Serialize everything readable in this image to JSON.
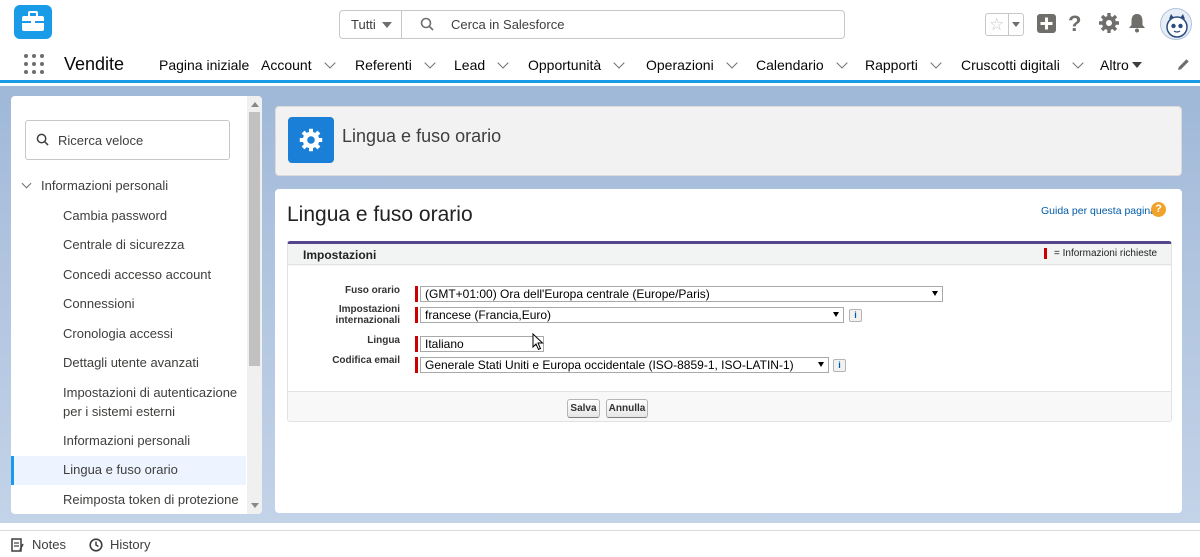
{
  "header": {
    "search_scope": "Tutti",
    "search_placeholder": "Cerca in Salesforce"
  },
  "nav": {
    "app_name": "Vendite",
    "items": [
      {
        "label": "Pagina iniziale",
        "has_menu": false
      },
      {
        "label": "Account",
        "has_menu": true
      },
      {
        "label": "Referenti",
        "has_menu": true
      },
      {
        "label": "Lead",
        "has_menu": true
      },
      {
        "label": "Opportunità",
        "has_menu": true
      },
      {
        "label": "Operazioni",
        "has_menu": true
      },
      {
        "label": "Calendario",
        "has_menu": true
      },
      {
        "label": "Rapporti",
        "has_menu": true
      },
      {
        "label": "Cruscotti digitali",
        "has_menu": true
      }
    ],
    "more_label": "Altro"
  },
  "sidebar": {
    "quick_search_placeholder": "Ricerca veloce",
    "section_title": "Informazioni personali",
    "items": [
      "Cambia password",
      "Centrale di sicurezza",
      "Concedi accesso account",
      "Connessioni",
      "Cronologia accessi",
      "Dettagli utente avanzati",
      "Impostazioni di autenticazione per i sistemi esterni",
      "Informazioni personali",
      "Lingua e fuso orario",
      "Reimposta token di protezione"
    ],
    "active_item": "Lingua e fuso orario"
  },
  "page_header": {
    "title": "Lingua e fuso orario"
  },
  "main": {
    "title": "Lingua e fuso orario",
    "help_link": "Guida per questa pagina",
    "help_icon": "?",
    "section_title": "Impostazioni",
    "required_note": "= Informazioni richieste",
    "fields": {
      "timezone_label": "Fuso orario",
      "timezone_value": "(GMT+01:00) Ora dell'Europa centrale (Europe/Paris)",
      "locale_label_1": "Impostazioni",
      "locale_label_2": "internazionali",
      "locale_value": "francese (Francia,Euro)",
      "language_label": "Lingua",
      "language_value": "Italiano",
      "encoding_label": "Codifica email",
      "encoding_value": "Generale Stati Uniti e Europa occidentale (ISO-8859-1, ISO-LATIN-1)"
    },
    "info_icon": "i",
    "save_label": "Salva",
    "cancel_label": "Annulla"
  },
  "utility_bar": {
    "notes_label": "Notes",
    "history_label": "History"
  },
  "colors": {
    "brand_blue": "#1a9be8",
    "required_red": "#cc0000",
    "section_border": "#56458c"
  }
}
